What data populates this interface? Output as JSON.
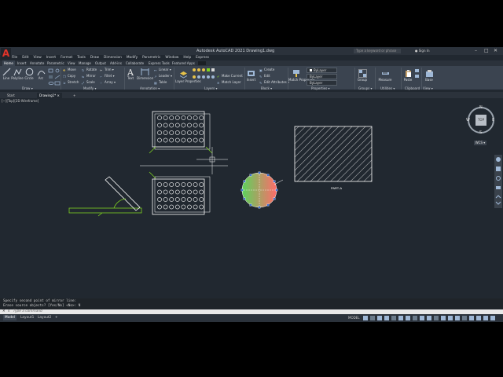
{
  "app": {
    "title": "Autodesk AutoCAD 2021   Drawing1.dwg",
    "logo_letter": "A",
    "search_placeholder": "Type a keyword or phrase",
    "sign_in": "Sign In",
    "window_controls": [
      "–",
      "□",
      "✕"
    ]
  },
  "menu": [
    "File",
    "Edit",
    "View",
    "Insert",
    "Format",
    "Tools",
    "Draw",
    "Dimension",
    "Modify",
    "Parametric",
    "Window",
    "Help",
    "Express"
  ],
  "ribbon_tabs": [
    "Home",
    "Insert",
    "Annotate",
    "Parametric",
    "View",
    "Manage",
    "Output",
    "Add-ins",
    "Collaborate",
    "Express Tools",
    "Featured Apps"
  ],
  "ribbon": {
    "draw": {
      "line": "Line",
      "polyline": "Polyline",
      "circle": "Circle",
      "arc": "Arc",
      "label": "Draw ▾"
    },
    "modify": {
      "move": "Move",
      "rotate": "Rotate",
      "trim": "Trim ▾",
      "copy": "Copy",
      "mirror": "Mirror",
      "fillet": "Fillet ▾",
      "stretch": "Stretch",
      "scale": "Scale",
      "array": "Array ▾",
      "label": "Modify ▾"
    },
    "annotation": {
      "text": "Text",
      "dimension": "Dimension",
      "linear": "Linear ▾",
      "leader": "Leader ▾",
      "table": "Table",
      "label": "Annotation ▾"
    },
    "layers": {
      "layer_properties": "Layer Properties",
      "make_current": "Make Current",
      "match_layer": "Match Layer",
      "layer_value": "0",
      "label": "Layers ▾"
    },
    "block": {
      "insert": "Insert",
      "create": "Create",
      "edit": "Edit",
      "edit_attributes": "Edit Attributes ▾",
      "label": "Block ▾"
    },
    "properties": {
      "match": "Match Properties",
      "bylayer1": "ByLayer",
      "bylayer2": "ByLayer",
      "bylayer3": "ByLayer",
      "label": "Properties ▾"
    },
    "groups": {
      "group": "Group",
      "label": "Groups ▾"
    },
    "utilities": {
      "measure": "Measure",
      "label": "Utilities ▾"
    },
    "clipboard": {
      "paste": "Paste",
      "label": "Clipboard"
    },
    "view": {
      "base": "Base",
      "label": "View ▾"
    }
  },
  "file_tabs": [
    "Start",
    "Drawing1*"
  ],
  "viewport_label": "[−][Top][2D Wireframe]",
  "drawing": {
    "rect_label": "PART-A",
    "accent_green": "#7ed321",
    "hatch_white": "#ffffff"
  },
  "viewcube": {
    "top": "TOP",
    "n": "N",
    "s": "S",
    "e": "E",
    "w": "W",
    "wcs": "WCS ▾"
  },
  "command": {
    "history": [
      "Specify second point of mirror line:",
      "Erase source objects? [Yes/No] <No>: N"
    ],
    "prompt": "Type a command"
  },
  "layout_tabs": [
    "Model",
    "Layout1",
    "Layout2"
  ],
  "status": {
    "model": "MODEL"
  }
}
